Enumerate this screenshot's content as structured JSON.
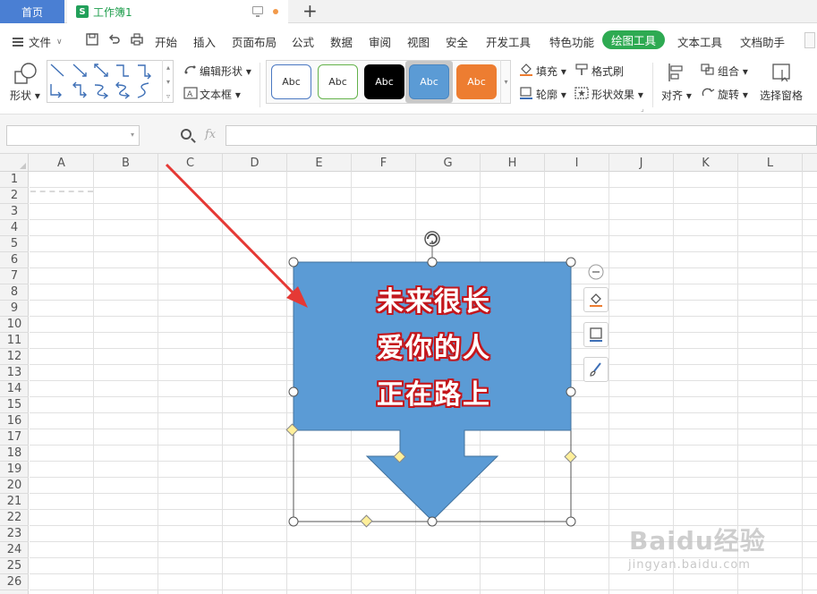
{
  "tabs": {
    "home": "首页",
    "workbook": "工作簿1"
  },
  "menu": {
    "file": "文件",
    "items": [
      "开始",
      "插入",
      "页面布局",
      "公式",
      "数据",
      "审阅",
      "视图",
      "安全",
      "开发工具",
      "特色功能"
    ],
    "active": "绘图工具",
    "after": [
      "文本工具",
      "文档助手"
    ]
  },
  "ribbon": {
    "shape": "形状",
    "edit_shape": "编辑形状",
    "text_box": "文本框",
    "styles": [
      "Abc",
      "Abc",
      "Abc",
      "Abc",
      "Abc"
    ],
    "fill": "填充",
    "format_painter": "格式刷",
    "outline": "轮廓",
    "shape_effects": "形状效果",
    "align": "对齐",
    "group": "组合",
    "rotate": "旋转",
    "selection_pane": "选择窗格"
  },
  "formula_bar": {
    "name_box": "",
    "fx": "fx",
    "formula": ""
  },
  "grid": {
    "columns": [
      "A",
      "B",
      "C",
      "D",
      "E",
      "F",
      "G",
      "H",
      "I",
      "J",
      "K",
      "L"
    ],
    "rows": [
      "1",
      "2",
      "3",
      "4",
      "5",
      "6",
      "7",
      "8",
      "9",
      "10",
      "11",
      "12",
      "13",
      "14",
      "15",
      "16",
      "17",
      "18",
      "19",
      "20",
      "21",
      "22",
      "23",
      "24",
      "25",
      "26"
    ]
  },
  "shape": {
    "text_lines": [
      "未来很长",
      "爱你的人",
      "正在路上"
    ],
    "fill_color": "#5b9bd5",
    "text_color": "#ffffff",
    "text_outline_color": "#c4161c"
  },
  "annotation": {
    "arrow_color": "#e53935"
  },
  "watermark": {
    "logo": "Baidu经验",
    "url": "jingyan.baidu.com"
  }
}
